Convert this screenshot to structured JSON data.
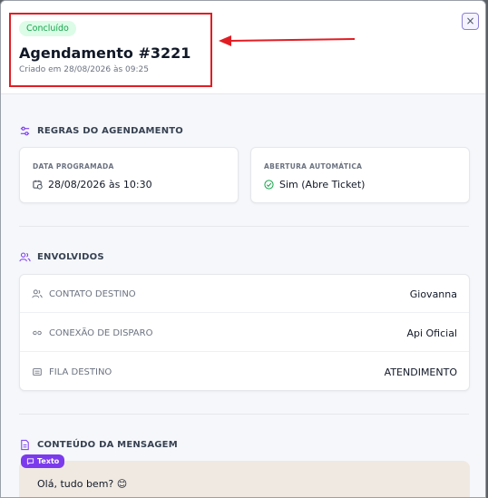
{
  "header": {
    "status_badge": "Concluído",
    "title": "Agendamento #3221",
    "subtitle": "Criado em 28/08/2026 às 09:25",
    "close_label": "×"
  },
  "rules": {
    "section_title": "REGRAS DO AGENDAMENTO",
    "scheduled_date": {
      "label": "DATA PROGRAMADA",
      "value": "28/08/2026 às 10:30"
    },
    "auto_open": {
      "label": "ABERTURA AUTOMÁTICA",
      "value": "Sim (Abre Ticket)"
    }
  },
  "involved": {
    "section_title": "ENVOLVIDOS",
    "rows": [
      {
        "label": "CONTATO DESTINO",
        "value": "Giovanna",
        "icon": "users-icon"
      },
      {
        "label": "CONEXÃO DE DISPARO",
        "value": "Api Oficial",
        "icon": "link-icon"
      },
      {
        "label": "FILA DESTINO",
        "value": "ATENDIMENTO",
        "icon": "inbox-icon"
      }
    ]
  },
  "message": {
    "section_title": "CONTEÚDO DA MENSAGEM",
    "type_tag": "Texto",
    "text": "Olá, tudo bem? 😊"
  },
  "colors": {
    "accent": "#7c3aed",
    "success": "#16a34a",
    "highlight": "#e11d24"
  }
}
